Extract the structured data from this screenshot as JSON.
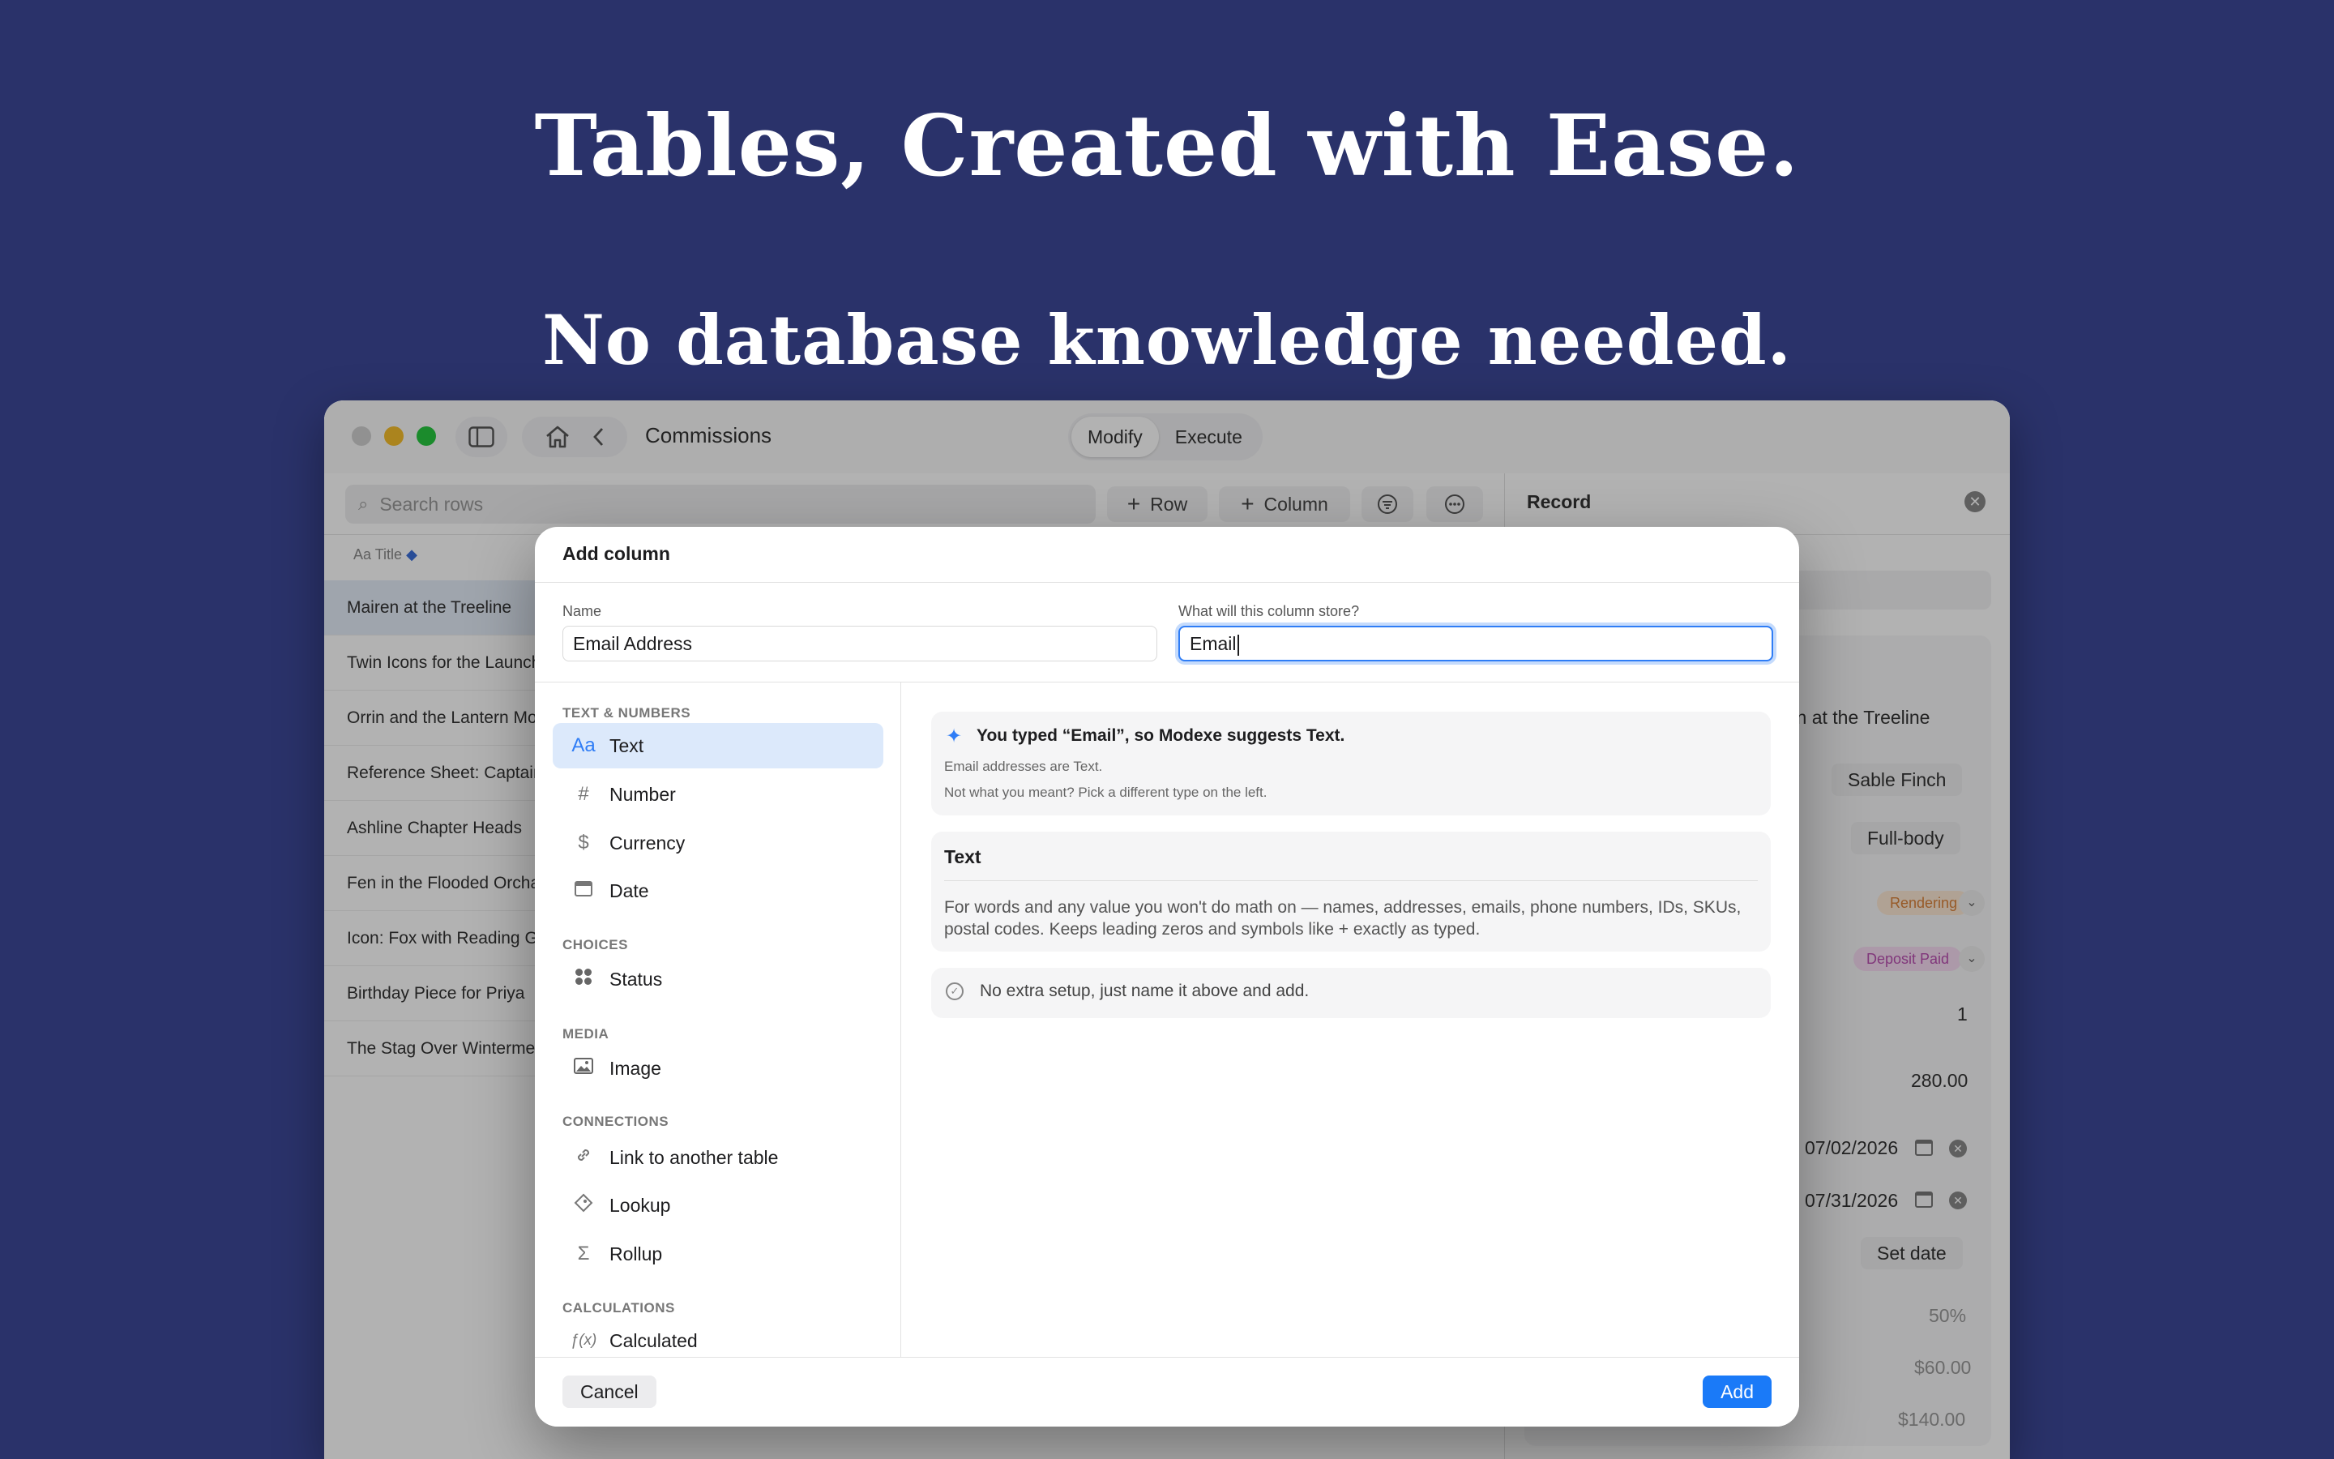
{
  "hero": {
    "headline": "Tables, Created with Ease.",
    "subheadline": "No database knowledge needed."
  },
  "window": {
    "title": "Commissions",
    "segments": [
      {
        "label": "Modify",
        "active": true
      },
      {
        "label": "Execute",
        "active": false
      }
    ],
    "search_placeholder": "Search rows",
    "add_row_label": "Row",
    "add_column_label": "Column",
    "record_title": "Record",
    "table": {
      "title_column": "Title",
      "rows": [
        "Mairen at the Treeline",
        "Twin Icons for the Launch",
        "Orrin and the Lantern Moth",
        "Reference Sheet: Captain",
        "Ashline Chapter Heads",
        "Fen in the Flooded Orchard",
        "Icon: Fox with Reading Glasses",
        "Birthday Piece for Priya",
        "The Stag Over Wintermere"
      ]
    },
    "record": {
      "title_value": "Mairen at the Treeline",
      "client": "Sable Finch",
      "size": "Full-body",
      "status": "Rendering",
      "payment": "Deposit Paid",
      "quantity": "1",
      "price": "280.00",
      "start_date": "07/02/2026",
      "due_date": "07/31/2026",
      "set_date": "Set date",
      "deposit_percent": "50%",
      "amount_a": "$60.00",
      "amount_b": "$140.00"
    }
  },
  "modal": {
    "title": "Add column",
    "name_label": "Name",
    "name_value": "Email Address",
    "store_label": "What will this column store?",
    "store_value": "Email",
    "sections": {
      "text_numbers": "TEXT & NUMBERS",
      "choices": "CHOICES",
      "media": "MEDIA",
      "connections": "CONNECTIONS",
      "calculations": "CALCULATIONS"
    },
    "types": {
      "text": "Text",
      "number": "Number",
      "currency": "Currency",
      "date": "Date",
      "status": "Status",
      "image": "Image",
      "link": "Link to another table",
      "lookup": "Lookup",
      "rollup": "Rollup",
      "calculated": "Calculated"
    },
    "suggestion": {
      "title": "You typed “Email”, so Modexe suggests Text.",
      "line1": "Email addresses are Text.",
      "line2": "Not what you meant? Pick a different type on the left."
    },
    "type_card": {
      "title": "Text",
      "description": "For words and any value you won't do math on — names, addresses, emails, phone numbers, IDs, SKUs, postal codes. Keeps leading zeros and symbols like + exactly as typed."
    },
    "no_setup": "No extra setup, just name it above and add.",
    "cancel_label": "Cancel",
    "add_label": "Add"
  },
  "colors": {
    "background": "#2a326a",
    "accent": "#1a7af8",
    "selected_type": "#dce9fb"
  }
}
